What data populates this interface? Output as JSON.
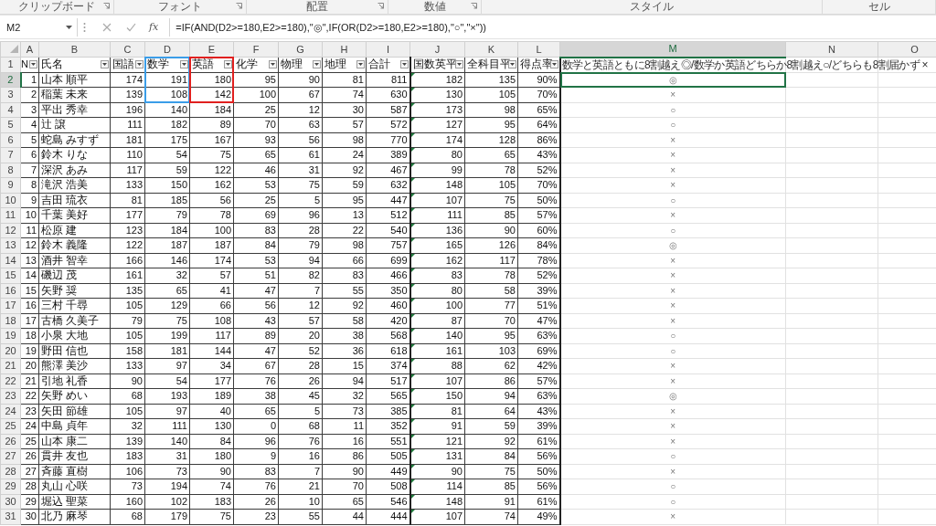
{
  "ribbon_groups": [
    {
      "label": "クリップボード",
      "launcher": true
    },
    {
      "label": "フォント",
      "launcher": true
    },
    {
      "label": "配置",
      "launcher": true
    },
    {
      "label": "数値",
      "launcher": true
    },
    {
      "label": "スタイル",
      "launcher": false
    },
    {
      "label": "セル",
      "launcher": false
    }
  ],
  "formula_bar": {
    "name_box": "M2",
    "insert_function": "fx",
    "formula": "=IF(AND(D2>=180,E2>=180),\"◎\",IF(OR(D2>=180,E2>=180),\"○\",\"×\"))"
  },
  "sheet": {
    "columns": [
      {
        "letter": "A",
        "selected": false
      },
      {
        "letter": "B",
        "selected": false
      },
      {
        "letter": "C",
        "selected": false
      },
      {
        "letter": "D",
        "selected": false
      },
      {
        "letter": "E",
        "selected": false
      },
      {
        "letter": "F",
        "selected": false
      },
      {
        "letter": "G",
        "selected": false
      },
      {
        "letter": "H",
        "selected": false
      },
      {
        "letter": "I",
        "selected": false
      },
      {
        "letter": "J",
        "selected": false
      },
      {
        "letter": "K",
        "selected": false
      },
      {
        "letter": "L",
        "selected": false
      },
      {
        "letter": "M",
        "selected": true
      },
      {
        "letter": "N",
        "selected": false
      },
      {
        "letter": "O",
        "selected": false
      }
    ],
    "header_row": {
      "row_number": "1",
      "selected": false,
      "cells": [
        {
          "text": "N",
          "filter": true
        },
        {
          "text": "氏名",
          "filter": true
        },
        {
          "text": "国語",
          "filter": true
        },
        {
          "text": "数学",
          "filter": true,
          "color": "#3a9de8"
        },
        {
          "text": "英語",
          "filter": true,
          "color": "#e0201f"
        },
        {
          "text": "化学",
          "filter": true
        },
        {
          "text": "物理",
          "filter": true
        },
        {
          "text": "地理",
          "filter": true
        },
        {
          "text": "合計",
          "filter": true
        },
        {
          "text": "国数英平",
          "filter": true
        },
        {
          "text": "全科目平",
          "filter": true
        },
        {
          "text": "得点率",
          "filter": true
        },
        {
          "text": "数学と英語ともに8割越え◎/数学か英語どちらか8割越え○/どちらも8割届かず ×",
          "filter": false
        }
      ]
    },
    "rows": [
      {
        "row_number": "2",
        "selected": true,
        "cells": [
          "1",
          "山本 順平",
          "174",
          {
            "text": "191",
            "color": "#3a9de8"
          },
          {
            "text": "180",
            "color": "#e0201f"
          },
          "95",
          "90",
          "81",
          "811",
          "182",
          "135",
          "90%",
          "◎"
        ]
      },
      {
        "row_number": "3",
        "selected": false,
        "cells": [
          "2",
          "稲葉 未来",
          "139",
          {
            "text": "108",
            "color": "#3a9de8"
          },
          {
            "text": "142",
            "color": "#e0201f"
          },
          "100",
          "67",
          "74",
          "630",
          "130",
          "105",
          "70%",
          "×"
        ]
      },
      {
        "row_number": "4",
        "selected": false,
        "cells": [
          "3",
          "平出 秀幸",
          "196",
          "140",
          "184",
          "25",
          "12",
          "30",
          "587",
          "173",
          "98",
          "65%",
          "○"
        ]
      },
      {
        "row_number": "5",
        "selected": false,
        "cells": [
          "4",
          "辻 譲",
          "111",
          "182",
          "89",
          "70",
          "63",
          "57",
          "572",
          "127",
          "95",
          "64%",
          "○"
        ]
      },
      {
        "row_number": "6",
        "selected": false,
        "cells": [
          "5",
          "蛇島 みすず",
          "181",
          "175",
          "167",
          "93",
          "56",
          "98",
          "770",
          "174",
          "128",
          "86%",
          "×"
        ]
      },
      {
        "row_number": "7",
        "selected": false,
        "cells": [
          "6",
          "鈴木 りな",
          "110",
          "54",
          "75",
          "65",
          "61",
          "24",
          "389",
          "80",
          "65",
          "43%",
          "×"
        ]
      },
      {
        "row_number": "8",
        "selected": false,
        "cells": [
          "7",
          "深沢 あみ",
          "117",
          "59",
          "122",
          "46",
          "31",
          "92",
          "467",
          "99",
          "78",
          "52%",
          "×"
        ]
      },
      {
        "row_number": "9",
        "selected": false,
        "cells": [
          "8",
          "滝沢 浩美",
          "133",
          "150",
          "162",
          "53",
          "75",
          "59",
          "632",
          "148",
          "105",
          "70%",
          "×"
        ]
      },
      {
        "row_number": "10",
        "selected": false,
        "cells": [
          "9",
          "吉田 琉衣",
          "81",
          "185",
          "56",
          "25",
          "5",
          "95",
          "447",
          "107",
          "75",
          "50%",
          "○"
        ]
      },
      {
        "row_number": "11",
        "selected": false,
        "cells": [
          "10",
          "千葉 美好",
          "177",
          "79",
          "78",
          "69",
          "96",
          "13",
          "512",
          "111",
          "85",
          "57%",
          "×"
        ]
      },
      {
        "row_number": "12",
        "selected": false,
        "cells": [
          "11",
          "松原 建",
          "123",
          "184",
          "100",
          "83",
          "28",
          "22",
          "540",
          "136",
          "90",
          "60%",
          "○"
        ]
      },
      {
        "row_number": "13",
        "selected": false,
        "cells": [
          "12",
          "鈴木 義隆",
          "122",
          "187",
          "187",
          "84",
          "79",
          "98",
          "757",
          "165",
          "126",
          "84%",
          "◎"
        ]
      },
      {
        "row_number": "14",
        "selected": false,
        "cells": [
          "13",
          "酒井 智幸",
          "166",
          "146",
          "174",
          "53",
          "94",
          "66",
          "699",
          "162",
          "117",
          "78%",
          "×"
        ]
      },
      {
        "row_number": "15",
        "selected": false,
        "cells": [
          "14",
          "磯辺 茂",
          "161",
          "32",
          "57",
          "51",
          "82",
          "83",
          "466",
          "83",
          "78",
          "52%",
          "×"
        ]
      },
      {
        "row_number": "16",
        "selected": false,
        "cells": [
          "15",
          "矢野 奨",
          "135",
          "65",
          "41",
          "47",
          "7",
          "55",
          "350",
          "80",
          "58",
          "39%",
          "×"
        ]
      },
      {
        "row_number": "17",
        "selected": false,
        "cells": [
          "16",
          "三村 千尋",
          "105",
          "129",
          "66",
          "56",
          "12",
          "92",
          "460",
          "100",
          "77",
          "51%",
          "×"
        ]
      },
      {
        "row_number": "18",
        "selected": false,
        "cells": [
          "17",
          "古橋 久美子",
          "79",
          "75",
          "108",
          "43",
          "57",
          "58",
          "420",
          "87",
          "70",
          "47%",
          "×"
        ]
      },
      {
        "row_number": "19",
        "selected": false,
        "cells": [
          "18",
          "小泉 大地",
          "105",
          "199",
          "117",
          "89",
          "20",
          "38",
          "568",
          "140",
          "95",
          "63%",
          "○"
        ]
      },
      {
        "row_number": "20",
        "selected": false,
        "cells": [
          "19",
          "野田 信也",
          "158",
          "181",
          "144",
          "47",
          "52",
          "36",
          "618",
          "161",
          "103",
          "69%",
          "○"
        ]
      },
      {
        "row_number": "21",
        "selected": false,
        "cells": [
          "20",
          "熊澤 美沙",
          "133",
          "97",
          "34",
          "67",
          "28",
          "15",
          "374",
          "88",
          "62",
          "42%",
          "×"
        ]
      },
      {
        "row_number": "22",
        "selected": false,
        "cells": [
          "21",
          "引地 礼香",
          "90",
          "54",
          "177",
          "76",
          "26",
          "94",
          "517",
          "107",
          "86",
          "57%",
          "×"
        ]
      },
      {
        "row_number": "23",
        "selected": false,
        "cells": [
          "22",
          "矢野 めい",
          "68",
          "193",
          "189",
          "38",
          "45",
          "32",
          "565",
          "150",
          "94",
          "63%",
          "◎"
        ]
      },
      {
        "row_number": "24",
        "selected": false,
        "cells": [
          "23",
          "矢田 節雄",
          "105",
          "97",
          "40",
          "65",
          "5",
          "73",
          "385",
          "81",
          "64",
          "43%",
          "×"
        ]
      },
      {
        "row_number": "25",
        "selected": false,
        "cells": [
          "24",
          "中島 貞年",
          "32",
          "111",
          "130",
          "0",
          "68",
          "11",
          "352",
          "91",
          "59",
          "39%",
          "×"
        ]
      },
      {
        "row_number": "26",
        "selected": false,
        "cells": [
          "25",
          "山本 康二",
          "139",
          "140",
          "84",
          "96",
          "76",
          "16",
          "551",
          "121",
          "92",
          "61%",
          "×"
        ]
      },
      {
        "row_number": "27",
        "selected": false,
        "cells": [
          "26",
          "貫井 友也",
          "183",
          "31",
          "180",
          "9",
          "16",
          "86",
          "505",
          "131",
          "84",
          "56%",
          "○"
        ]
      },
      {
        "row_number": "28",
        "selected": false,
        "cells": [
          "27",
          "斉藤 直樹",
          "106",
          "73",
          "90",
          "83",
          "7",
          "90",
          "449",
          "90",
          "75",
          "50%",
          "×"
        ]
      },
      {
        "row_number": "29",
        "selected": false,
        "cells": [
          "28",
          "丸山 心咲",
          "73",
          "194",
          "74",
          "76",
          "21",
          "70",
          "508",
          "114",
          "85",
          "56%",
          "○"
        ]
      },
      {
        "row_number": "30",
        "selected": false,
        "cells": [
          "29",
          "堀込 聖菜",
          "160",
          "102",
          "183",
          "26",
          "10",
          "65",
          "546",
          "148",
          "91",
          "61%",
          "○"
        ]
      },
      {
        "row_number": "31",
        "selected": false,
        "cells": [
          "30",
          "北乃 麻琴",
          "68",
          "179",
          "75",
          "23",
          "55",
          "44",
          "444",
          "107",
          "74",
          "49%",
          "×"
        ]
      }
    ]
  }
}
